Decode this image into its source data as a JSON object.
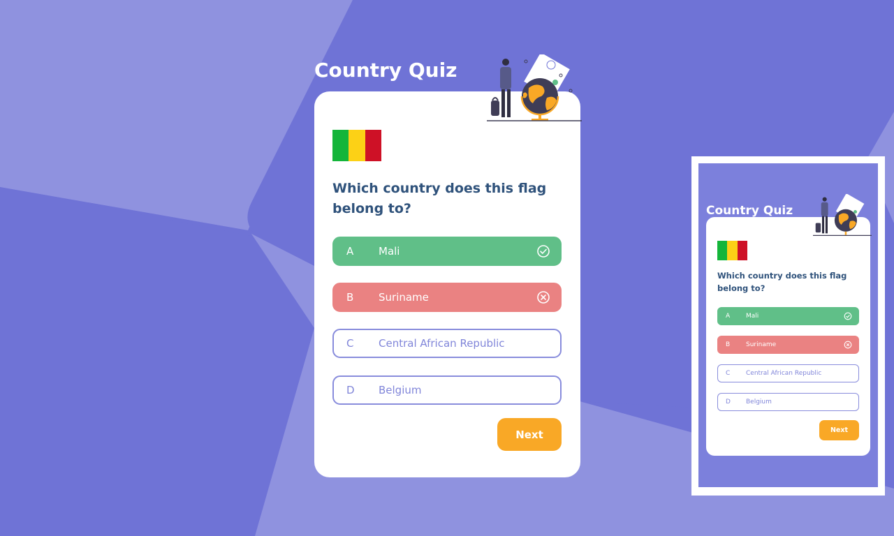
{
  "title": "Country Quiz",
  "question": "Which country does this flag belong to?",
  "flag": {
    "colors": [
      "#14b53a",
      "#fcd116",
      "#ce1126"
    ]
  },
  "options": [
    {
      "letter": "A",
      "text": "Mali",
      "state": "correct",
      "icon": "check-circle-icon"
    },
    {
      "letter": "B",
      "text": "Suriname",
      "state": "wrong",
      "icon": "x-circle-icon"
    },
    {
      "letter": "C",
      "text": "Central African Republic",
      "state": "default"
    },
    {
      "letter": "D",
      "text": "Belgium",
      "state": "default"
    }
  ],
  "next_label": "Next",
  "colors": {
    "background": "#6f73d6",
    "accent": "#f9a826",
    "correct": "#60bf88",
    "wrong": "#ea8282",
    "question_text": "#2f527b",
    "option_border": "#6066d0"
  }
}
